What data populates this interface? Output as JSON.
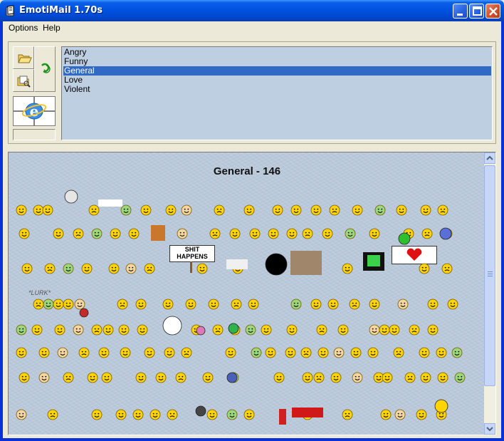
{
  "window": {
    "title": "EmotiMail 1.70s"
  },
  "menu": {
    "options": "Options",
    "help": "Help"
  },
  "toolbar": {
    "open_icon": "folder-open-icon",
    "browse_icon": "folder-search-icon",
    "refresh_icon": "green-refresh-icon",
    "preview_icon": "internet-explorer-icon"
  },
  "categories": {
    "items": [
      "Angry",
      "Funny",
      "General",
      "Love",
      "Violent"
    ],
    "selected": "General"
  },
  "panel": {
    "title": "General - 146",
    "signs": {
      "shit_happens_line1": "SHIT",
      "shit_happens_line2": "HAPPENS"
    },
    "lurk_text": "*LURK*"
  },
  "colors": {
    "titlebar": "#0053e1",
    "selection": "#316ac5",
    "panel_bg": "#bac9da",
    "smiley": "#ffd400"
  }
}
